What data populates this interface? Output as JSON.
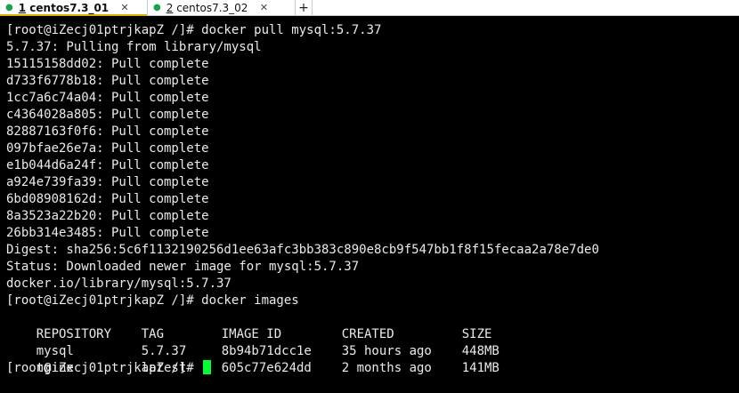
{
  "tabs": [
    {
      "number": "1",
      "name": "centos7.3_01",
      "status_color": "#16a34a",
      "close": "✕"
    },
    {
      "number": "2",
      "name": "centos7.3_02",
      "status_color": "#16a34a",
      "close": "✕"
    }
  ],
  "new_tab_label": "+",
  "terminal": {
    "pull_lines": [
      "[root@iZecj01ptrjkapZ /]# docker pull mysql:5.7.37",
      "5.7.37: Pulling from library/mysql",
      "15115158dd02: Pull complete",
      "d733f6778b18: Pull complete",
      "1cc7a6c74a04: Pull complete",
      "c4364028a805: Pull complete",
      "82887163f0f6: Pull complete",
      "097bfae26e7a: Pull complete",
      "e1b044d6a24f: Pull complete",
      "a924e739fa39: Pull complete",
      "6bd08908162d: Pull complete",
      "8a3523a22b20: Pull complete",
      "26bb314e3485: Pull complete",
      "Digest: sha256:5c6f1132190256d1ee63afc3bb383c890e8cb9f547bb1f8f15fecaa2a78e7de0",
      "Status: Downloaded newer image for mysql:5.7.37",
      "docker.io/library/mysql:5.7.37",
      "[root@iZecj01ptrjkapZ /]# docker images"
    ],
    "images_header": {
      "repository": "REPOSITORY",
      "tag": "TAG",
      "image_id": "IMAGE ID",
      "created": "CREATED",
      "size": "SIZE"
    },
    "images": [
      {
        "repository": "mysql",
        "tag": "5.7.37",
        "image_id": "8b94b71dcc1e",
        "created": "35 hours ago",
        "size": "448MB"
      },
      {
        "repository": "nginx",
        "tag": "latest",
        "image_id": "605c77e624dd",
        "created": "2 months ago",
        "size": "141MB"
      }
    ],
    "prompt": "[root@iZecj01ptrjkapZ /]# ",
    "cursor_color": "#00ff33"
  }
}
